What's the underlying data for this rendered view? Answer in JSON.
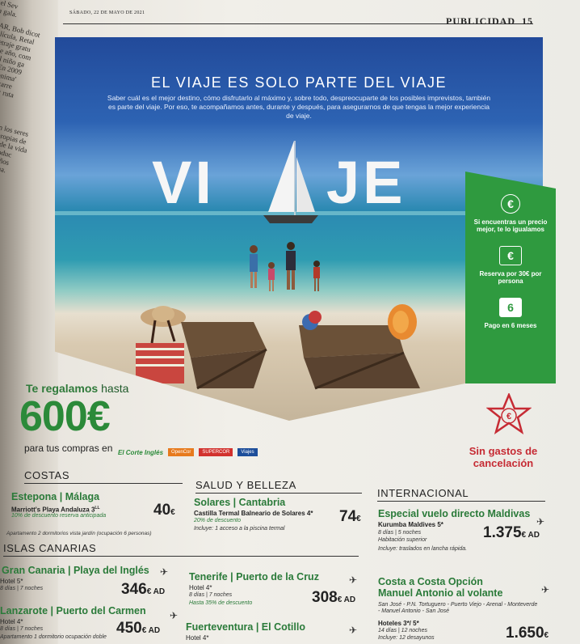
{
  "header": {
    "date": "SÁBADO, 22 DE MAYO DE 2021",
    "section": "PUBLICIDAD",
    "page_number": "15"
  },
  "gutter_lines": [
    "el Sev",
    "a gala.",
    "AR, Bob dicot",
    "elícula, Retal",
    "netraje gratu",
    "Ese año, com",
    "y el niño ga",
    "ar, En 2009",
    "'Anonima'",
    "n tu carre",
    "nción: ruta",
    "n los seres",
    "propias de",
    "s de la vida",
    "",
    "rroduc",
    "a años",
    "cama."
  ],
  "hero": {
    "title": "EL VIAJE ES SOLO PARTE DEL VIAJE",
    "description": "Saber cuál es el mejor destino, cómo disfrutarlo al máximo y, sobre todo, despreocuparte de los posibles imprevistos, también es parte del viaje. Por eso, te acompañamos antes, durante y después, para asegurarnos de que tengas la mejor experiencia de viaje.",
    "word_left": "VI",
    "word_right": "JE"
  },
  "benefits": [
    {
      "icon": "euro-coin-icon",
      "glyph": "€",
      "text": "Si encuentras un precio mejor, te lo igualamos"
    },
    {
      "icon": "euro-card-icon",
      "glyph": "€",
      "text": "Reserva por 30€ por persona"
    },
    {
      "icon": "calendar-icon",
      "glyph": "6",
      "text": "Pago en 6 meses"
    }
  ],
  "promo": {
    "prefix": "Te regalamos",
    "suffix": "hasta",
    "amount": "600€",
    "purchase_text": "para tus compras en",
    "logos": [
      "El Corte Inglés",
      "OpenCor",
      "SUPERCOR",
      "Viajes"
    ]
  },
  "cancel": {
    "line1": "Sin gastos de",
    "line2": "cancelación"
  },
  "sections": {
    "costas": "COSTAS",
    "salud": "SALUD Y BELLEZA",
    "internacional": "INTERNACIONAL",
    "islas": "ISLAS CANARIAS"
  },
  "offers": {
    "estepona": {
      "title": "Estepona | Málaga",
      "hotel": "Marriott's Playa Andaluza 3",
      "hotel_sup": "LL",
      "discount": "10% de descuento reserva anticipada",
      "note": "Apartamento 2 dormitorios vista jardín (ocupación 6 personas)",
      "price": "40",
      "cur": "€"
    },
    "solares": {
      "title": "Solares | Cantabria",
      "hotel": "Castilla Termal Balneario de Solares 4*",
      "discount": "20% de descuento",
      "note": "Incluye: 1 acceso a la piscina termal",
      "price": "74",
      "cur": "€"
    },
    "maldivas": {
      "title": "Especial vuelo directo Maldivas",
      "hotel": "Kurumba Maldives 5*",
      "nights": "8 días | 5 noches",
      "room": "Habitación superior",
      "note": "Incluye: traslados en lancha rápida.",
      "price": "1.375",
      "cur": "€ AD"
    },
    "gran_canaria": {
      "title": "Gran Canaria | Playa del Inglés",
      "hotel": "Hotel 5*",
      "nights": "8 días | 7 noches",
      "price": "346",
      "cur": "€ AD"
    },
    "tenerife": {
      "title": "Tenerife | Puerto de la Cruz",
      "hotel": "Hotel 4*",
      "nights": "8 días | 7 noches",
      "discount": "Hasta 35% de descuento",
      "price": "308",
      "cur": "€ AD"
    },
    "costa": {
      "title": "Costa a Costa Opción Manuel Antonio al volante",
      "route": "San José - P.N. Tortuguero - Puerto Viejo - Arenal - Monteverde - Manuel Antonio - San José",
      "hotel": "Hoteles 3*/ 5*",
      "nights": "14 días | 12 noches",
      "include": "Incluye: 12 desayunos",
      "price": "1.650",
      "cur": "€"
    },
    "lanzarote": {
      "title": "Lanzarote | Puerto del Carmen",
      "hotel": "Hotel 4*",
      "nights": "8 días | 7 noches",
      "note": "Apartamento 1 dormitorio ocupación doble",
      "price": "450",
      "cur": "€ AD"
    },
    "fuerteventura": {
      "title": "Fuerteventura | El Cotillo",
      "hotel": "Hotel 4*"
    }
  },
  "colors": {
    "brand_green": "#2f9a3f",
    "alert_red": "#c62b34",
    "sky_blue": "#2d63b3"
  }
}
